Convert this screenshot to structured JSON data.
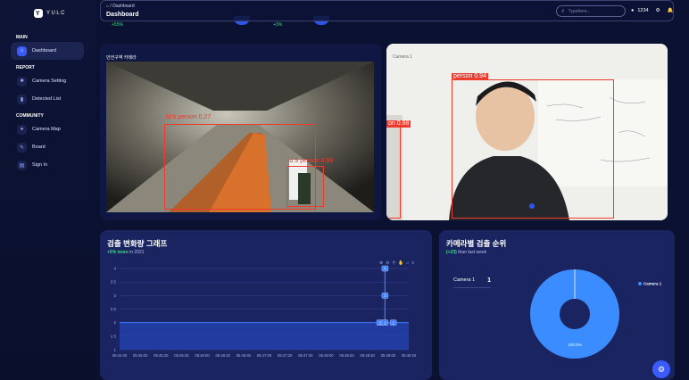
{
  "brand": {
    "name": "YULC"
  },
  "sidebar": {
    "main_label": "MAIN",
    "report_label": "REPORT",
    "community_label": "COMMUNITY",
    "items": [
      {
        "label": "Dashboard",
        "icon": "home-icon"
      },
      {
        "label": "Camera Setting",
        "icon": "camera-icon"
      },
      {
        "label": "Detected List",
        "icon": "bar-chart-icon"
      },
      {
        "label": "Camera Map",
        "icon": "globe-icon"
      },
      {
        "label": "Board",
        "icon": "wrench-icon"
      },
      {
        "label": "Sign In",
        "icon": "document-icon"
      }
    ]
  },
  "header": {
    "breadcrumb_sep": "/",
    "breadcrumb": "Dashboard",
    "title": "Dashboard",
    "search_placeholder": "Typehere...",
    "user_name": "1234",
    "stat1": "+55%",
    "stat2": "+3%"
  },
  "camera1": {
    "label": "안전구역 카메라",
    "detections": [
      {
        "text": "id:6  person  0.27"
      },
      {
        "text": "id:9  person  0.90"
      }
    ]
  },
  "camera2": {
    "label": "Camera 1",
    "detections": [
      {
        "text": "person  0.94"
      },
      {
        "text": "on  0.88"
      }
    ]
  },
  "line_chart": {
    "title": "검출 변화량 그래프",
    "subtitle_highlight": "+5% more",
    "subtitle_rest": "in 2021"
  },
  "rank_chart": {
    "title": "카메라별 검출 순위",
    "subtitle_highlight": "(+23)",
    "subtitle_rest": "than last week",
    "camera_name": "Camera 1",
    "camera_count": "1"
  },
  "chart_data": [
    {
      "type": "area",
      "title": "검출 변화량 그래프",
      "x": [
        "05:44:40",
        "05:45:00",
        "05:45:20",
        "05:45:40",
        "05:46:00",
        "05:46:20",
        "05:46:40",
        "05:47:00",
        "05:47:20",
        "05:47:40",
        "05:48:00",
        "05:48:20",
        "05:48:40",
        "05:49:00",
        "05:49:20"
      ],
      "ylim": [
        1,
        4
      ],
      "yticks": [
        "1",
        "1.5",
        "2",
        "2.5",
        "3",
        "3.5",
        "4"
      ],
      "baseline": 2,
      "points": [
        {
          "x": "05:48:52",
          "y": 2
        },
        {
          "x": "05:48:57",
          "y": 2
        },
        {
          "x": "05:48:57",
          "y": 3
        },
        {
          "x": "05:48:57",
          "y": 4
        },
        {
          "x": "05:49:05",
          "y": 2
        }
      ],
      "point_labels": [
        "2",
        "2",
        "3",
        "4",
        "2"
      ],
      "accent": "#3b7bff",
      "grid": true
    },
    {
      "type": "pie",
      "title": "카메라별 검출 순위",
      "series": [
        {
          "name": "Camera 1",
          "values": [
            100
          ]
        }
      ],
      "data_labels": [
        "100.0%"
      ],
      "legend": "top-right",
      "accent": "#3b8cff"
    }
  ],
  "toolbar_icons": [
    "zoom-in-icon",
    "zoom-out-icon",
    "zoom-icon",
    "pan-icon",
    "home-icon",
    "menu-icon"
  ],
  "fab": {
    "icon": "gear-icon"
  }
}
